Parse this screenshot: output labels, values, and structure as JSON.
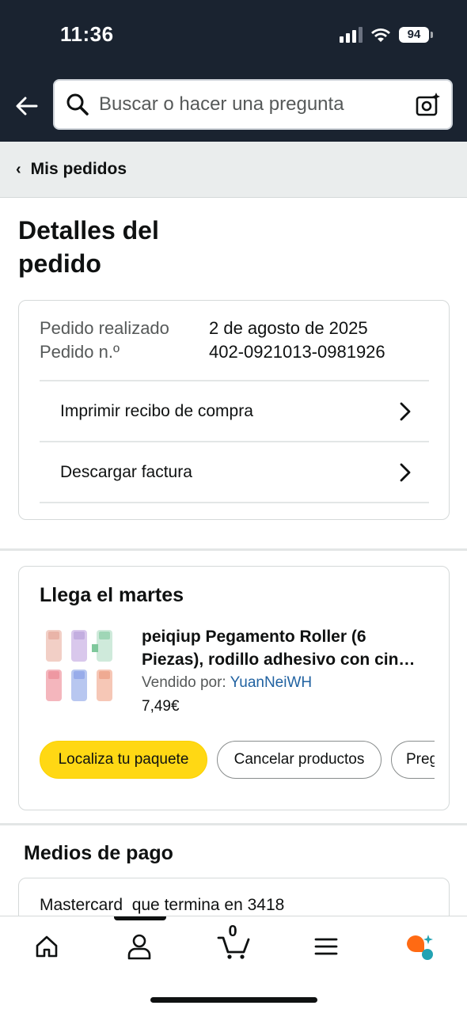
{
  "status_bar": {
    "time": "11:36",
    "battery": "94"
  },
  "search": {
    "placeholder": "Buscar o hacer una pregunta"
  },
  "breadcrumb": {
    "label": "Mis pedidos"
  },
  "page": {
    "title": "Detalles del pedido"
  },
  "order_info": {
    "placed_label": "Pedido realizado",
    "placed_value": "2 de agosto de 2025",
    "number_label": "Pedido n.º",
    "number_value": "402-0921013-0981926",
    "links": [
      {
        "label": "Imprimir recibo de compra"
      },
      {
        "label": "Descargar factura"
      }
    ]
  },
  "shipment": {
    "heading": "Llega el martes",
    "product_title": "peiqiup Pegamento Roller (6 Piezas), rodillo adhesivo con cin…",
    "sold_by_label": "Vendido por:",
    "seller": "YuanNeiWH",
    "price": "7,49€",
    "actions": [
      {
        "label": "Localiza tu paquete"
      },
      {
        "label": "Cancelar productos"
      },
      {
        "label": "Preg"
      }
    ]
  },
  "payment": {
    "heading": "Medios de pago",
    "method": "Mastercard  que termina en 3418"
  },
  "tabbar": {
    "cart_count": "0",
    "items": [
      "home-icon",
      "account-icon",
      "cart-icon",
      "menu-icon",
      "rufus-icon"
    ]
  },
  "colors": {
    "header_bg": "#1a2330",
    "primary_button": "#ffd814",
    "link": "#2162a1"
  }
}
